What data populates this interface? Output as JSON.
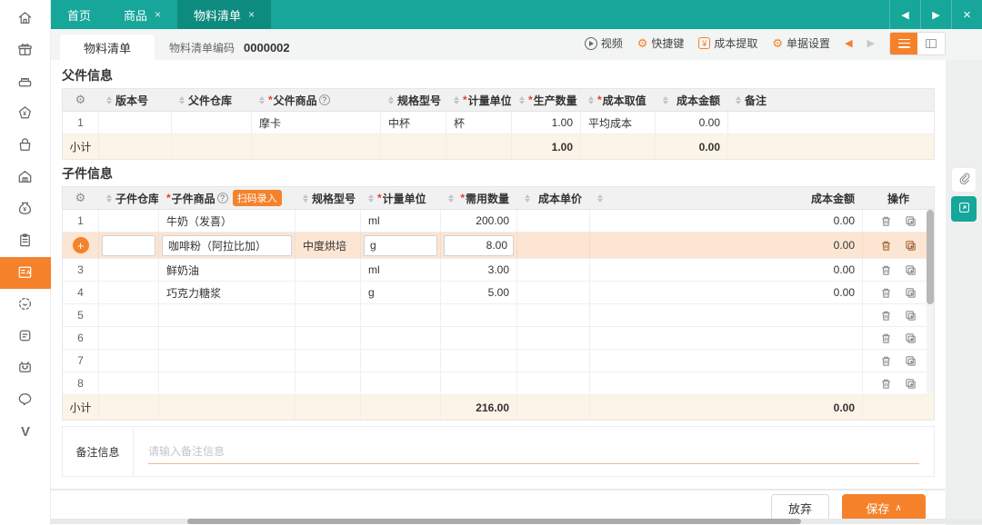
{
  "icons": {
    "plus": "+",
    "close": "×",
    "back": "◀",
    "forward": "▶",
    "gear": "⚙",
    "help": "?",
    "required": "*",
    "chevron_up": "∧"
  },
  "colors": {
    "teal": "#16a69a",
    "teal_dark": "#0e8b7f",
    "accent_orange": "#f5822b",
    "active_row_bg": "#fce5d3",
    "subtotal_bg": "#fcf4e6"
  },
  "topbar": {
    "tabs": [
      {
        "label": "首页"
      },
      {
        "label": "商品"
      },
      {
        "label": "物料清单"
      }
    ]
  },
  "subheader": {
    "doc_tab": "物料清单",
    "code_label": "物料清单编码",
    "code_value": "0000002",
    "toolbar": {
      "video": "视频",
      "hotkeys": "快捷键",
      "cost_extract": "成本提取",
      "doc_settings": "单据设置"
    }
  },
  "parent": {
    "title": "父件信息",
    "headers": {
      "version": "版本号",
      "warehouse": "父件仓库",
      "product": "父件商品",
      "spec": "规格型号",
      "unit": "计量单位",
      "qty": "生产数量",
      "cost_method": "成本取值",
      "cost_amount": "成本金额",
      "remark": "备注"
    },
    "row": {
      "no": "1",
      "product": "摩卡",
      "spec": "中杯",
      "unit": "杯",
      "qty": "1.00",
      "cost_method": "平均成本",
      "cost_amount": "0.00"
    },
    "subtotal": {
      "label": "小计",
      "qty": "1.00",
      "cost_amount": "0.00"
    }
  },
  "child": {
    "title": "子件信息",
    "headers": {
      "warehouse": "子件仓库",
      "product": "子件商品",
      "scan": "扫码录入",
      "spec": "规格型号",
      "unit": "计量单位",
      "qty": "需用数量",
      "cost_price": "成本单价",
      "cost_amount": "成本金额",
      "ops": "操作"
    },
    "rows": [
      {
        "no": "1",
        "product": "牛奶（发喜）",
        "spec": "",
        "unit": "ml",
        "qty": "200.00",
        "cost_amount": "0.00"
      },
      {
        "no": "+",
        "product": "咖啡粉（阿拉比加）",
        "spec": "中度烘培",
        "unit": "g",
        "qty": "8.00",
        "cost_amount": "0.00"
      },
      {
        "no": "3",
        "product": "鲜奶油",
        "spec": "",
        "unit": "ml",
        "qty": "3.00",
        "cost_amount": "0.00"
      },
      {
        "no": "4",
        "product": "巧克力糖浆",
        "spec": "",
        "unit": "g",
        "qty": "5.00",
        "cost_amount": "0.00"
      },
      {
        "no": "5"
      },
      {
        "no": "6"
      },
      {
        "no": "7"
      },
      {
        "no": "8"
      }
    ],
    "subtotal": {
      "label": "小计",
      "qty": "216.00",
      "cost_amount": "0.00"
    }
  },
  "remark": {
    "label": "备注信息",
    "placeholder": "请输入备注信息"
  },
  "footer": {
    "cancel": "放弃",
    "save": "保存"
  }
}
